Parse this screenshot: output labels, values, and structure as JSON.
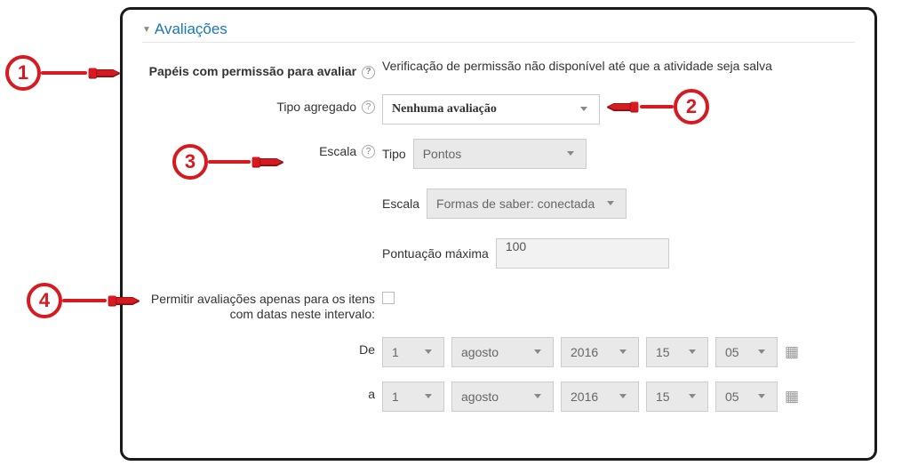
{
  "section": {
    "title": "Avaliações"
  },
  "labels": {
    "roles": "Papéis com permissão para avaliar",
    "aggregate": "Tipo agregado",
    "scale": "Escala",
    "subtype": "Tipo",
    "subscale": "Escala",
    "maxscore": "Pontuação máxima",
    "restrict": "Permitir avaliações apenas para os itens com datas neste intervalo:",
    "from": "De",
    "to": "a"
  },
  "values": {
    "roles_text": "Verificação de permissão não disponível até que a atividade seja salva",
    "aggregate": "Nenhuma avaliação",
    "subtype": "Pontos",
    "subscale": "Formas de saber: conectada",
    "maxscore": "100"
  },
  "date_from": {
    "day": "1",
    "month": "agosto",
    "year": "2016",
    "hour": "15",
    "minute": "05"
  },
  "date_to": {
    "day": "1",
    "month": "agosto",
    "year": "2016",
    "hour": "15",
    "minute": "05"
  },
  "callouts": {
    "c1": "1",
    "c2": "2",
    "c3": "3",
    "c4": "4"
  }
}
